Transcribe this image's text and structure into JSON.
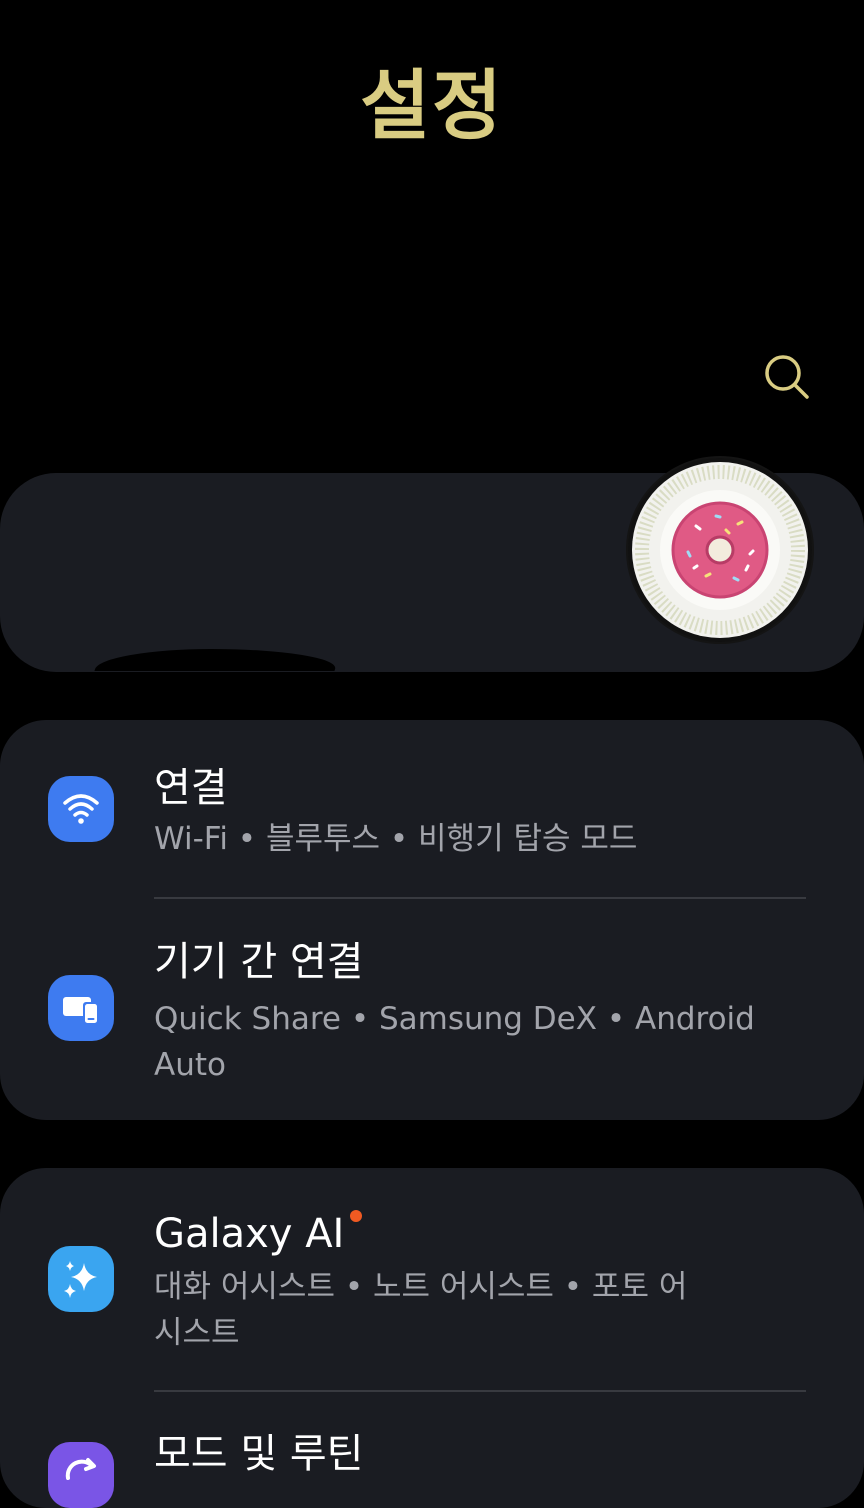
{
  "header": {
    "title": "설정"
  },
  "search": {
    "icon": "search-icon"
  },
  "profile": {
    "avatar_icon": "donut-avatar"
  },
  "connections_group": {
    "items": [
      {
        "title": "연결",
        "subtitle": "Wi-Fi  •  블루투스  •  비행기 탑승 모드",
        "icon": "wifi-icon",
        "icon_color": "#3e7bf0"
      },
      {
        "title": "기기 간 연결",
        "subtitle": "Quick Share  •  Samsung DeX  •  Android Auto",
        "icon": "devices-icon",
        "icon_color": "#3e7bf0"
      }
    ]
  },
  "features_group": {
    "items": [
      {
        "title": "Galaxy AI",
        "subtitle": "대화 어시스트  •  노트 어시스트  •  포토 어시스트",
        "icon": "sparkle-icon",
        "icon_color": "#3aa5f0",
        "badge_color": "#f05a22"
      },
      {
        "title": "모드 및 루틴",
        "icon": "routine-icon",
        "icon_color": "#7a55e6"
      }
    ]
  },
  "colors": {
    "accent": "#d9cc82",
    "card_bg": "#1a1c22",
    "background": "#000000",
    "subtitle_text": "#a2a4ab"
  }
}
